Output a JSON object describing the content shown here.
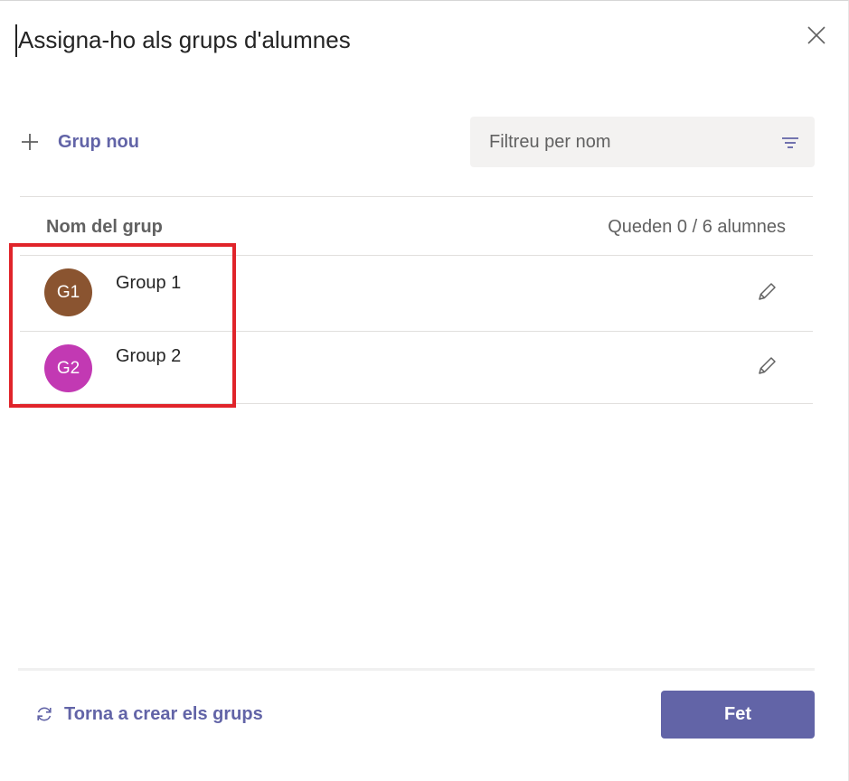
{
  "dialog": {
    "title": "Assigna-ho als grups d'alumnes"
  },
  "toolbar": {
    "new_group_label": "Grup nou",
    "filter_placeholder": "Filtreu per nom",
    "filter_value": ""
  },
  "table": {
    "header_name": "Nom del grup",
    "header_count": "Queden 0 / 6 alumnes",
    "groups": [
      {
        "initials": "G1",
        "name": "Group 1",
        "avatar_color": "#8a5430"
      },
      {
        "initials": "G2",
        "name": "Group 2",
        "avatar_color": "#c239b3"
      }
    ]
  },
  "footer": {
    "recreate_label": "Torna a crear els grups",
    "done_label": "Fet"
  },
  "colors": {
    "accent": "#6264a7",
    "highlight": "#e0242a"
  },
  "icons": {
    "close": "close-icon",
    "plus": "plus-icon",
    "filter": "filter-icon",
    "edit": "pencil-icon",
    "refresh": "refresh-icon"
  }
}
